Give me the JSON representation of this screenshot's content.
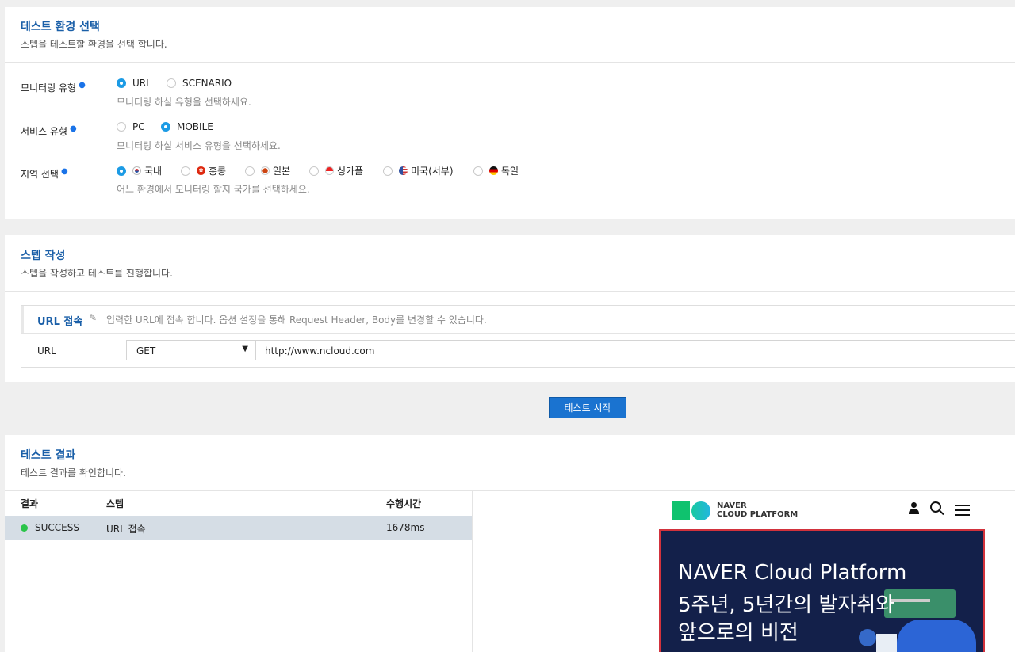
{
  "env": {
    "title": "테스트 환경 선택",
    "subtitle": "스텝을 테스트할 환경을 선택 합니다.",
    "monitoring_type": {
      "label": "모니터링 유형",
      "options": [
        "URL",
        "SCENARIO"
      ],
      "selected": "URL",
      "hint": "모니터링 하실 유형을 선택하세요."
    },
    "service_type": {
      "label": "서비스 유형",
      "options": [
        "PC",
        "MOBILE"
      ],
      "selected": "MOBILE",
      "hint": "모니터링 하실 서비스 유형을 선택하세요."
    },
    "region": {
      "label": "지역 선택",
      "options": [
        "국내",
        "홍콩",
        "일본",
        "싱가폴",
        "미국(서부)",
        "독일"
      ],
      "selected": "국내",
      "hint": "어느 환경에서 모니터링 할지 국가를 선택하세요."
    }
  },
  "step": {
    "title": "스텝 작성",
    "subtitle": "스텝을 작성하고 테스트를 진행합니다.",
    "panel_title": "URL 접속",
    "panel_desc": "입력한 URL에 접속 합니다. 옵션 설정을 통해 Request Header, Body를 변경할 수 있습니다.",
    "url_label": "URL",
    "method": "GET",
    "url_value": "http://www.ncloud.com"
  },
  "start_button": "테스트 시작",
  "result": {
    "title": "테스트 결과",
    "subtitle": "테스트 결과를 확인합니다.",
    "columns": [
      "결과",
      "스텝",
      "수행시간"
    ],
    "rows": [
      {
        "status": "SUCCESS",
        "step": "URL 접속",
        "time": "1678ms"
      }
    ]
  },
  "preview": {
    "brand_line1": "NAVER",
    "brand_line2": "CLOUD PLATFORM",
    "banner_line1": "NAVER Cloud Platform",
    "banner_line2": "5주년, 5년간의 발자취와",
    "banner_line3": "앞으로의 비전"
  },
  "colors": {
    "accent": "#1a73d0",
    "title_blue": "#1a5fa8",
    "radio_on": "#1c9be5",
    "success": "#2bc44a",
    "banner_bg": "#13204a",
    "banner_border": "#d2323c"
  }
}
